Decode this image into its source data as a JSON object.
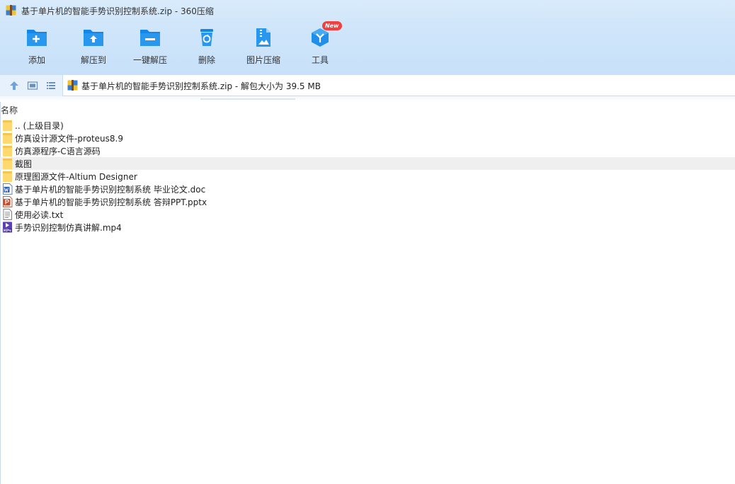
{
  "window": {
    "title": "基于单片机的智能手势识别控制系统.zip - 360压缩"
  },
  "toolbar": {
    "items": [
      {
        "label": "添加",
        "icon": "folder-add-icon"
      },
      {
        "label": "解压到",
        "icon": "folder-extract-icon"
      },
      {
        "label": "一键解压",
        "icon": "folder-minus-icon"
      },
      {
        "label": "删除",
        "icon": "trash-icon"
      },
      {
        "label": "图片压缩",
        "icon": "image-compress-icon"
      },
      {
        "label": "工具",
        "icon": "tools-cube-icon"
      }
    ],
    "new_badge": "New"
  },
  "address": {
    "text": "基于单片机的智能手势识别控制系统.zip - 解包大小为 39.5 MB"
  },
  "list": {
    "column_name": "名称",
    "rows": [
      {
        "name": ".. (上级目录)",
        "type": "folder"
      },
      {
        "name": "仿真设计源文件-proteus8.9",
        "type": "folder"
      },
      {
        "name": "仿真源程序-C语言源码",
        "type": "folder"
      },
      {
        "name": "截图",
        "type": "folder"
      },
      {
        "name": "原理图源文件-Altium Designer",
        "type": "folder"
      },
      {
        "name": "基于单片机的智能手势识别控制系统 毕业论文.doc",
        "type": "doc"
      },
      {
        "name": "基于单片机的智能手势识别控制系统 答辩PPT.pptx",
        "type": "ppt"
      },
      {
        "name": "使用必读.txt",
        "type": "txt"
      },
      {
        "name": "手势识别控制仿真讲解.mp4",
        "type": "mp4"
      }
    ],
    "selected_index": 3
  },
  "colors": {
    "accent": "#1c8ce8",
    "folder": "#ffd970",
    "badge": "#f04141"
  }
}
